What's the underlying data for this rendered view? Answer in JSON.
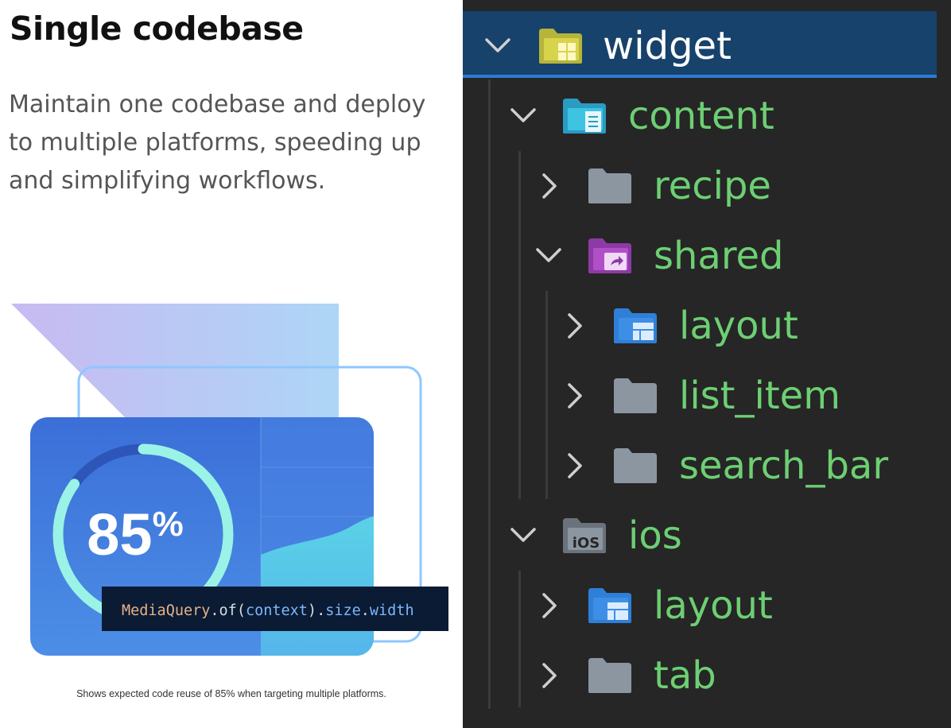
{
  "intro": {
    "title": "Single codebase",
    "description": "Maintain one codebase and deploy to multiple platforms, speeding up and simplifying workflows.",
    "stat_value": "85",
    "stat_unit": "%",
    "progress_fraction": 0.85,
    "code": {
      "class_name": "MediaQuery",
      "dot1": ".",
      "method": "of",
      "paren_open": "(",
      "arg": "context",
      "paren_close": ")",
      "dot2": ".",
      "prop1": "size",
      "dot3": ".",
      "prop2": "width"
    },
    "caption": "Shows expected code reuse of 85% when targeting multiple platforms."
  },
  "tree": {
    "root": {
      "label": "widget",
      "expanded": true,
      "icon": "widget-folder-icon"
    },
    "items": [
      {
        "label": "content",
        "expanded": true,
        "icon": "content-folder-icon"
      },
      {
        "label": "recipe",
        "expanded": false,
        "icon": "folder-icon"
      },
      {
        "label": "shared",
        "expanded": true,
        "icon": "shared-folder-icon"
      },
      {
        "label": "layout",
        "expanded": false,
        "icon": "layout-folder-icon"
      },
      {
        "label": "list_item",
        "expanded": false,
        "icon": "folder-icon"
      },
      {
        "label": "search_bar",
        "expanded": false,
        "icon": "folder-icon"
      },
      {
        "label": "ios",
        "expanded": true,
        "icon": "ios-folder-icon"
      },
      {
        "label": "layout",
        "expanded": false,
        "icon": "layout-folder-icon"
      },
      {
        "label": "tab",
        "expanded": false,
        "icon": "folder-icon"
      }
    ]
  },
  "colors": {
    "tree_background": "#262626",
    "header_background": "#17426b",
    "header_border": "#2c7bd4",
    "label_green": "#6dcf73",
    "folder_gray": "#8b96a1",
    "folder_blue": "#3d8fe6",
    "folder_purple": "#b04fc8",
    "folder_cyan": "#3ec3e3",
    "folder_olive": "#b7b43a",
    "card_blue": "#3d74dc",
    "ring_mint": "#9af3e6",
    "code_background": "#0a1b33"
  }
}
